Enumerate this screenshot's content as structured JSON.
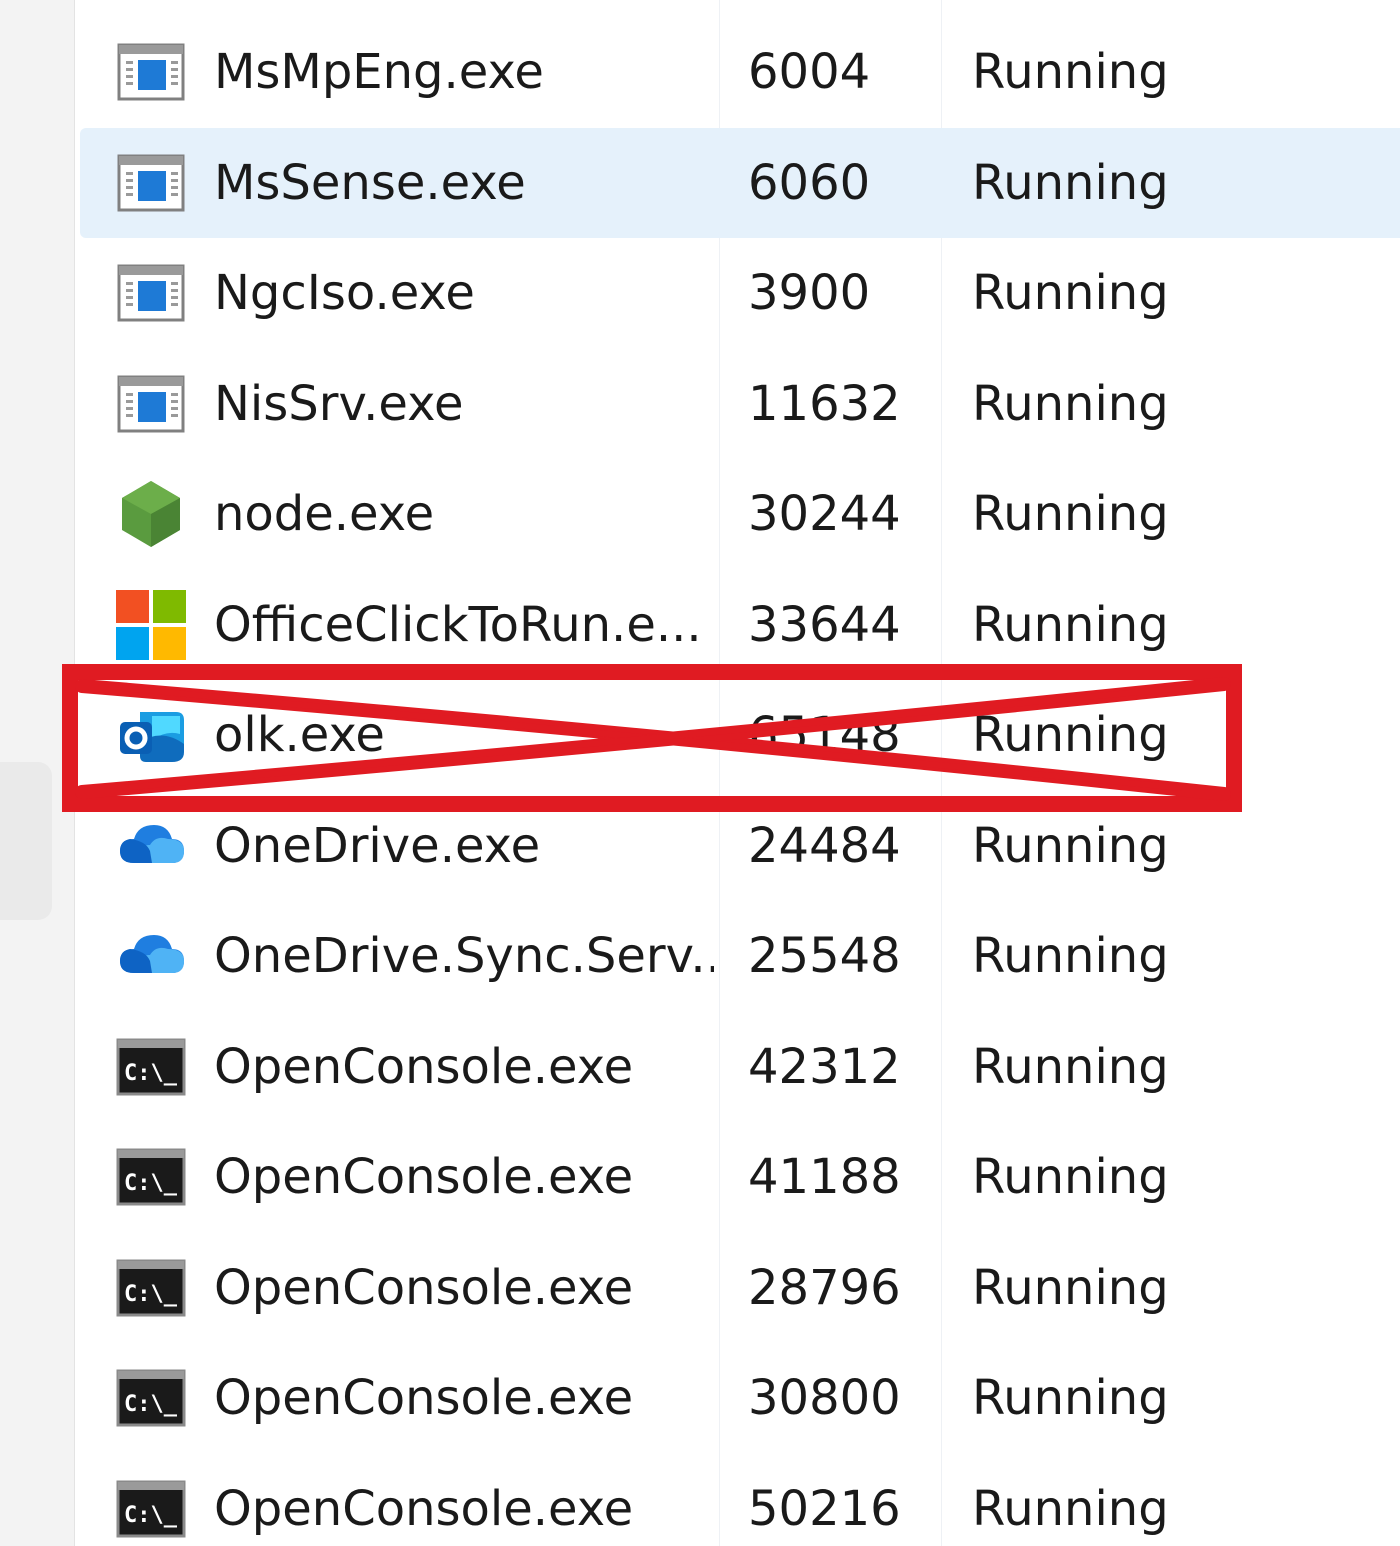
{
  "processes": [
    {
      "name": "MsMpEng.exe",
      "pid": "6004",
      "status": "Running",
      "icon": "service-window-icon"
    },
    {
      "name": "MsSense.exe",
      "pid": "6060",
      "status": "Running",
      "icon": "service-window-icon",
      "selected": true
    },
    {
      "name": "NgcIso.exe",
      "pid": "3900",
      "status": "Running",
      "icon": "service-window-icon"
    },
    {
      "name": "NisSrv.exe",
      "pid": "11632",
      "status": "Running",
      "icon": "service-window-icon"
    },
    {
      "name": "node.exe",
      "pid": "30244",
      "status": "Running",
      "icon": "nodejs-hexagon-icon"
    },
    {
      "name": "OfficeClickToRun.e...",
      "pid": "33644",
      "status": "Running",
      "icon": "office-squares-icon"
    },
    {
      "name": "olk.exe",
      "pid": "65148",
      "status": "Running",
      "icon": "outlook-icon",
      "crossed_out": true
    },
    {
      "name": "OneDrive.exe",
      "pid": "24484",
      "status": "Running",
      "icon": "onedrive-cloud-icon"
    },
    {
      "name": "OneDrive.Sync.Serv...",
      "pid": "25548",
      "status": "Running",
      "icon": "onedrive-cloud-icon"
    },
    {
      "name": "OpenConsole.exe",
      "pid": "42312",
      "status": "Running",
      "icon": "console-icon"
    },
    {
      "name": "OpenConsole.exe",
      "pid": "41188",
      "status": "Running",
      "icon": "console-icon"
    },
    {
      "name": "OpenConsole.exe",
      "pid": "28796",
      "status": "Running",
      "icon": "console-icon"
    },
    {
      "name": "OpenConsole.exe",
      "pid": "30800",
      "status": "Running",
      "icon": "console-icon"
    },
    {
      "name": "OpenConsole.exe",
      "pid": "50216",
      "status": "Running",
      "icon": "console-icon"
    }
  ],
  "colors": {
    "selected_row": "#e5f1fb",
    "annotation_red": "#e01b22"
  }
}
